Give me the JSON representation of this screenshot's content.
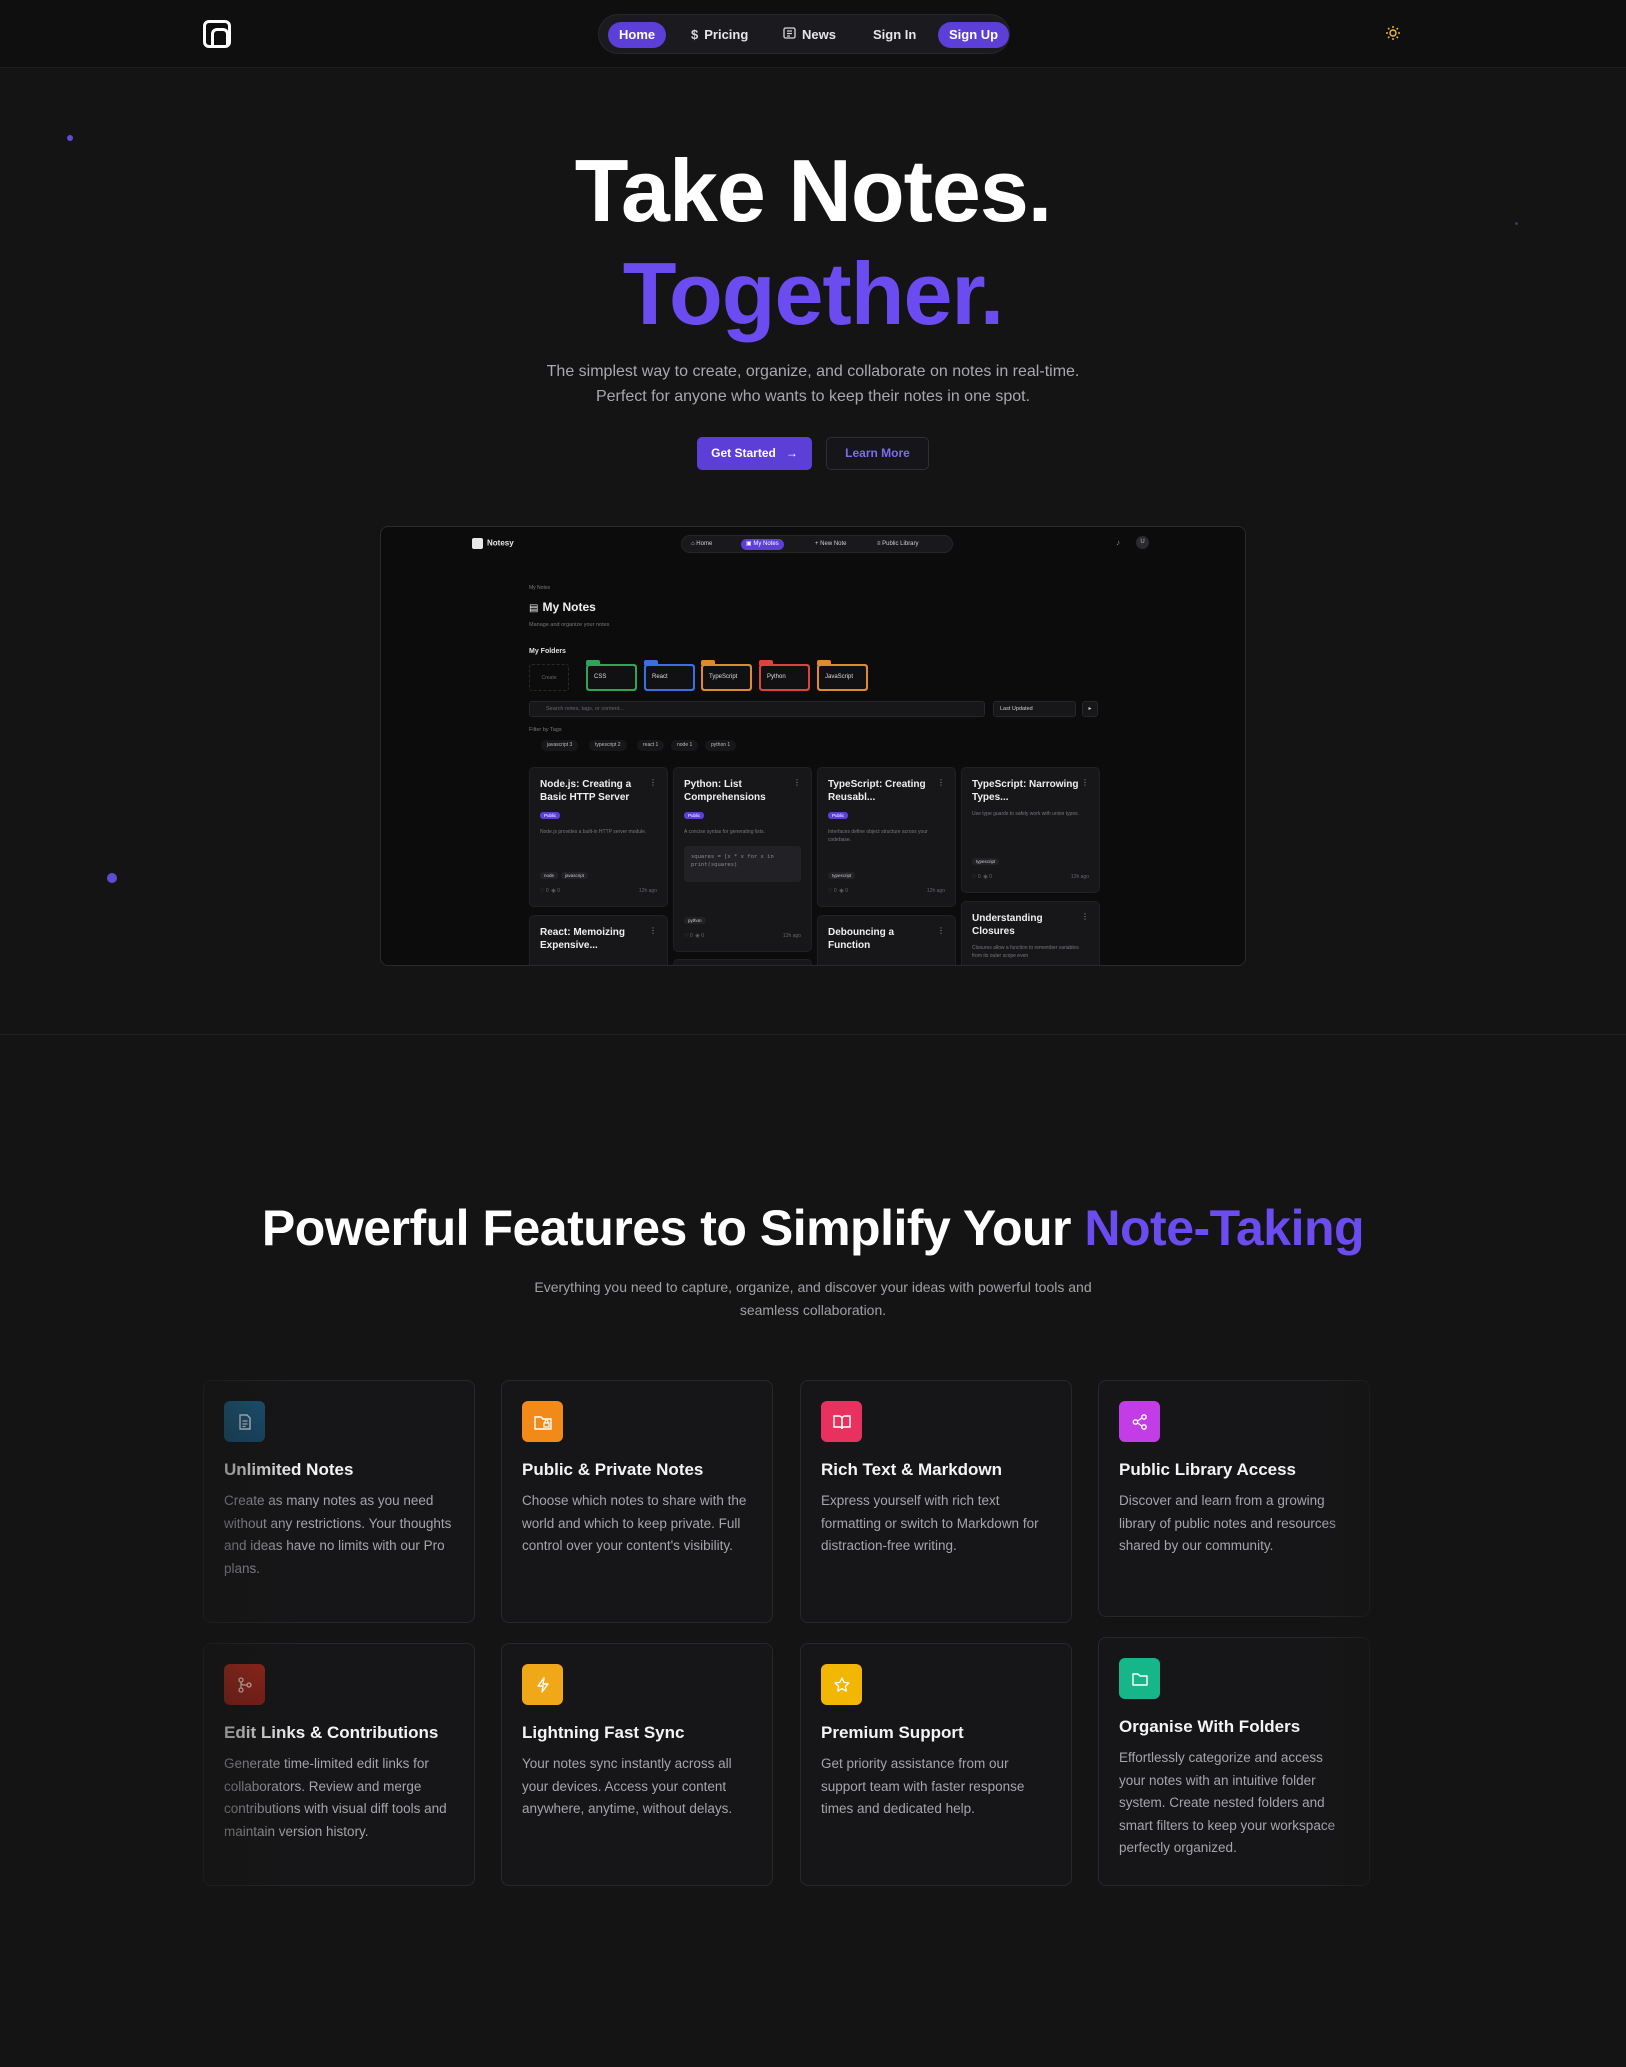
{
  "nav": {
    "items": [
      {
        "label": "Home",
        "icon": ""
      },
      {
        "label": "Pricing",
        "icon": "$"
      },
      {
        "label": "News",
        "icon": "newspaper-icon"
      },
      {
        "label": "Sign In",
        "icon": ""
      },
      {
        "label": "Sign Up",
        "icon": ""
      }
    ],
    "theme_icon": "sun-icon",
    "active_color": "#5b3fd6"
  },
  "hero": {
    "title_line1": "Take Notes.",
    "title_line2": "Together.",
    "subtitle": "The simplest way to create, organize, and collaborate on notes in real-time. Perfect for anyone who wants to keep their notes in one spot.",
    "primary_button": "Get Started",
    "secondary_button": "Learn More"
  },
  "preview": {
    "brand": "Notesy",
    "nav": [
      "Home",
      "My Notes",
      "New Note",
      "Public Library"
    ],
    "avatar": "U",
    "breadcrumb": "My Notes",
    "title": "My Notes",
    "description": "Manage and organize your notes",
    "folders_label": "My Folders",
    "create_label": "Create",
    "folders": [
      {
        "name": "CSS",
        "color": "#2fa35a"
      },
      {
        "name": "React",
        "color": "#3a6fe0"
      },
      {
        "name": "TypeScript",
        "color": "#e08a2e"
      },
      {
        "name": "Python",
        "color": "#d9453a"
      },
      {
        "name": "JavaScript",
        "color": "#e08a2e"
      }
    ],
    "search_placeholder": "Search notes, tags, or content...",
    "sort": "Last Updated",
    "tags_label": "Filter by Tags",
    "tags": [
      "javascript 3",
      "typescript 2",
      "react 1",
      "node 1",
      "python 1"
    ],
    "cards": [
      {
        "title": "Node.js: Creating a Basic HTTP Server",
        "badge": "Public",
        "desc": "Node.js provides a built-in HTTP server module.",
        "tags": [
          "node",
          "javascript"
        ],
        "likes": "0",
        "views": "0",
        "time": "12h ago"
      },
      {
        "title": "Python: List Comprehensions",
        "badge": "Public",
        "desc": "A concise syntax for generating lists.",
        "code": "squares = [x * x for x in\nprint(squares)",
        "tags": [
          "python"
        ],
        "likes": "0",
        "views": "0",
        "time": "12h ago"
      },
      {
        "title": "TypeScript: Creating Reusabl...",
        "badge": "Public",
        "desc": "Interfaces define object structure across your codebase.",
        "tags": [
          "typescript"
        ],
        "likes": "0",
        "views": "0",
        "time": "12h ago"
      },
      {
        "title": "TypeScript: Narrowing Types...",
        "badge": "",
        "desc": "Use type guards to safely work with union types.",
        "tags": [
          "typescript"
        ],
        "likes": "0",
        "views": "0",
        "time": "12h ago"
      },
      {
        "title": "React: Memoizing Expensive...",
        "badge": "",
        "desc": "",
        "tags": [],
        "likes": "",
        "views": "",
        "time": ""
      },
      {
        "title": "Debouncing a Function",
        "badge": "",
        "desc": "",
        "tags": [],
        "likes": "",
        "views": "",
        "time": ""
      },
      {
        "title": "Understanding Closures",
        "badge": "",
        "desc": "Closures allow a function to remember variables from its outer scope even",
        "tags": [],
        "likes": "",
        "views": "",
        "time": ""
      }
    ]
  },
  "features": {
    "title_main": "Powerful Features to Simplify Your ",
    "title_accent": "Note-Taking",
    "subtitle": "Everything you need to capture, organize, and discover your ideas with powerful tools and seamless collaboration.",
    "items": [
      {
        "name": "Unlimited Notes",
        "desc": "Create as many notes as you need without any restrictions. Your thoughts and ideas have no limits with our Pro plans.",
        "icon": "document-icon",
        "color": "#1f5f8b"
      },
      {
        "name": "Public & Private Notes",
        "desc": "Choose which notes to share with the world and which to keep private. Full control over your content's visibility.",
        "icon": "folder-lock-icon",
        "color": "#f28a1a"
      },
      {
        "name": "Rich Text & Markdown",
        "desc": "Express yourself with rich text formatting or switch to Markdown for distraction-free writing.",
        "icon": "book-open-icon",
        "color": "#e8315f"
      },
      {
        "name": "Public Library Access",
        "desc": "Discover and learn from a growing library of public notes and resources shared by our community.",
        "icon": "share-icon",
        "color": "#c23de6"
      },
      {
        "name": "Edit Links & Contributions",
        "desc": "Generate time-limited edit links for collaborators. Review and merge contributions with visual diff tools and maintain version history.",
        "icon": "git-branch-icon",
        "color": "#b3261e"
      },
      {
        "name": "Lightning Fast Sync",
        "desc": "Your notes sync instantly across all your devices. Access your content anywhere, anytime, without delays.",
        "icon": "lightning-icon",
        "color": "#f0a818"
      },
      {
        "name": "Premium Support",
        "desc": "Get priority assistance from our support team with faster response times and dedicated help.",
        "icon": "star-icon",
        "color": "#f2b705"
      },
      {
        "name": "Organise With Folders",
        "desc": "Effortlessly categorize and access your notes with an intuitive folder system. Create nested folders and smart filters to keep your workspace perfectly organized.",
        "icon": "folder-icon",
        "color": "#16b58a"
      }
    ]
  }
}
